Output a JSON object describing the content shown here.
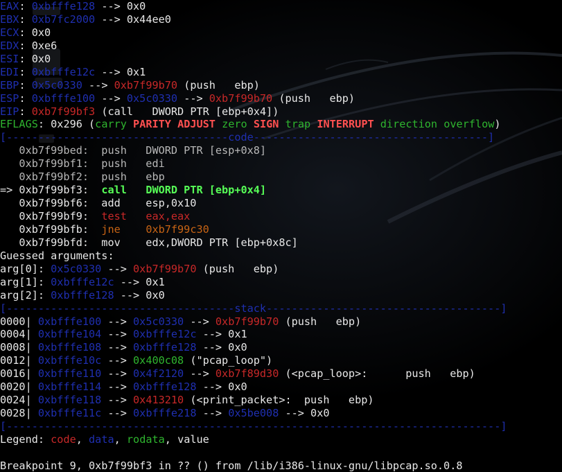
{
  "terminal": {
    "lines": [
      [
        {
          "t": "EAX",
          "c": "blue"
        },
        {
          "t": ": ",
          "c": "white"
        },
        {
          "t": "0xbfffe128",
          "c": "blue"
        },
        {
          "t": " --> 0x0",
          "c": "white"
        }
      ],
      [
        {
          "t": "EBX",
          "c": "blue"
        },
        {
          "t": ": ",
          "c": "white"
        },
        {
          "t": "0xb7fc2000",
          "c": "blue"
        },
        {
          "t": " --> 0x44ee0",
          "c": "white"
        }
      ],
      [
        {
          "t": "ECX",
          "c": "blue"
        },
        {
          "t": ": 0x0",
          "c": "white"
        }
      ],
      [
        {
          "t": "EDX",
          "c": "blue"
        },
        {
          "t": ": 0xe6",
          "c": "white"
        }
      ],
      [
        {
          "t": "ESI",
          "c": "blue"
        },
        {
          "t": ": 0x0",
          "c": "white"
        }
      ],
      [
        {
          "t": "EDI",
          "c": "blue"
        },
        {
          "t": ": ",
          "c": "white"
        },
        {
          "t": "0xbfffe12c",
          "c": "blue"
        },
        {
          "t": " --> 0x1",
          "c": "white"
        }
      ],
      [
        {
          "t": "EBP",
          "c": "blue"
        },
        {
          "t": ": ",
          "c": "white"
        },
        {
          "t": "0x5c0330",
          "c": "blue"
        },
        {
          "t": " --> ",
          "c": "white"
        },
        {
          "t": "0xb7f99b70",
          "c": "red"
        },
        {
          "t": " (push   ebp)",
          "c": "white"
        }
      ],
      [
        {
          "t": "ESP",
          "c": "blue"
        },
        {
          "t": ": ",
          "c": "white"
        },
        {
          "t": "0xbfffe100",
          "c": "blue"
        },
        {
          "t": " --> ",
          "c": "white"
        },
        {
          "t": "0x5c0330",
          "c": "blue"
        },
        {
          "t": " --> ",
          "c": "white"
        },
        {
          "t": "0xb7f99b70",
          "c": "red"
        },
        {
          "t": " (push   ebp)",
          "c": "white"
        }
      ],
      [
        {
          "t": "EIP",
          "c": "blue"
        },
        {
          "t": ": ",
          "c": "white"
        },
        {
          "t": "0xb7f99bf3",
          "c": "red"
        },
        {
          "t": " (call   DWORD PTR [ebp+0x4])",
          "c": "white"
        }
      ],
      [
        {
          "t": "EFLAGS",
          "c": "green"
        },
        {
          "t": ": 0x296 (",
          "c": "white"
        },
        {
          "t": "carry",
          "c": "green"
        },
        {
          "t": " ",
          "c": "white"
        },
        {
          "t": "PARITY",
          "c": "redb"
        },
        {
          "t": " ",
          "c": "white"
        },
        {
          "t": "ADJUST",
          "c": "redb"
        },
        {
          "t": " ",
          "c": "white"
        },
        {
          "t": "zero",
          "c": "green"
        },
        {
          "t": " ",
          "c": "white"
        },
        {
          "t": "SIGN",
          "c": "redb"
        },
        {
          "t": " ",
          "c": "white"
        },
        {
          "t": "trap",
          "c": "green"
        },
        {
          "t": " ",
          "c": "white"
        },
        {
          "t": "INTERRUPT",
          "c": "redb"
        },
        {
          "t": " ",
          "c": "white"
        },
        {
          "t": "direction",
          "c": "green"
        },
        {
          "t": " ",
          "c": "white"
        },
        {
          "t": "overflow",
          "c": "green"
        },
        {
          "t": ")",
          "c": "white"
        }
      ],
      [
        {
          "t": "[-----------------------------------code-------------------------------------]",
          "c": "banner"
        }
      ],
      [
        {
          "t": "   0xb7f99bed:\tpush   DWORD PTR [esp+0x8]",
          "c": "gray"
        }
      ],
      [
        {
          "t": "   0xb7f99bf1:\tpush   edi",
          "c": "gray"
        }
      ],
      [
        {
          "t": "   0xb7f99bf2:\tpush   ebp",
          "c": "gray"
        }
      ],
      [
        {
          "t": "=> 0xb7f99bf3:\t",
          "c": "white"
        },
        {
          "t": "call   DWORD PTR [ebp+0x4]",
          "c": "greenb"
        }
      ],
      [
        {
          "t": "   0xb7f99bf6:\tadd    esp,0x10",
          "c": "white"
        }
      ],
      [
        {
          "t": "   0xb7f99bf9:\t",
          "c": "white"
        },
        {
          "t": "test   eax,eax",
          "c": "red"
        }
      ],
      [
        {
          "t": "   0xb7f99bfb:\t",
          "c": "white"
        },
        {
          "t": "jne    0xb7f99c30",
          "c": "orange"
        }
      ],
      [
        {
          "t": "   0xb7f99bfd:\tmov    edx,DWORD PTR [ebp+0x8c]",
          "c": "white"
        }
      ],
      [
        {
          "t": "Guessed arguments:",
          "c": "white"
        }
      ],
      [
        {
          "t": "arg[0]: ",
          "c": "white"
        },
        {
          "t": "0x5c0330",
          "c": "blue"
        },
        {
          "t": " --> ",
          "c": "white"
        },
        {
          "t": "0xb7f99b70",
          "c": "red"
        },
        {
          "t": " (push   ebp)",
          "c": "white"
        }
      ],
      [
        {
          "t": "arg[1]: ",
          "c": "white"
        },
        {
          "t": "0xbfffe12c",
          "c": "blue"
        },
        {
          "t": " --> 0x1",
          "c": "white"
        }
      ],
      [
        {
          "t": "arg[2]: ",
          "c": "white"
        },
        {
          "t": "0xbfffe128",
          "c": "blue"
        },
        {
          "t": " --> 0x0",
          "c": "white"
        }
      ],
      [
        {
          "t": "[------------------------------------stack-------------------------------------]",
          "c": "banner"
        }
      ],
      [
        {
          "t": "0000| ",
          "c": "white"
        },
        {
          "t": "0xbfffe100",
          "c": "blue"
        },
        {
          "t": " --> ",
          "c": "white"
        },
        {
          "t": "0x5c0330",
          "c": "blue"
        },
        {
          "t": " --> ",
          "c": "white"
        },
        {
          "t": "0xb7f99b70",
          "c": "red"
        },
        {
          "t": " (push   ebp)",
          "c": "white"
        }
      ],
      [
        {
          "t": "0004| ",
          "c": "white"
        },
        {
          "t": "0xbfffe104",
          "c": "blue"
        },
        {
          "t": " --> ",
          "c": "white"
        },
        {
          "t": "0xbfffe12c",
          "c": "blue"
        },
        {
          "t": " --> 0x1",
          "c": "white"
        }
      ],
      [
        {
          "t": "0008| ",
          "c": "white"
        },
        {
          "t": "0xbfffe108",
          "c": "blue"
        },
        {
          "t": " --> ",
          "c": "white"
        },
        {
          "t": "0xbfffe128",
          "c": "blue"
        },
        {
          "t": " --> 0x0",
          "c": "white"
        }
      ],
      [
        {
          "t": "0012| ",
          "c": "white"
        },
        {
          "t": "0xbfffe10c",
          "c": "blue"
        },
        {
          "t": " --> ",
          "c": "white"
        },
        {
          "t": "0x400c08",
          "c": "green"
        },
        {
          "t": " (\"pcap_loop\")",
          "c": "white"
        }
      ],
      [
        {
          "t": "0016| ",
          "c": "white"
        },
        {
          "t": "0xbfffe110",
          "c": "blue"
        },
        {
          "t": " --> ",
          "c": "white"
        },
        {
          "t": "0x4f2120",
          "c": "blue"
        },
        {
          "t": " --> ",
          "c": "white"
        },
        {
          "t": "0xb7f89d30",
          "c": "red"
        },
        {
          "t": " (<pcap_loop>:\tpush   ebp)",
          "c": "white"
        }
      ],
      [
        {
          "t": "0020| ",
          "c": "white"
        },
        {
          "t": "0xbfffe114",
          "c": "blue"
        },
        {
          "t": " --> ",
          "c": "white"
        },
        {
          "t": "0xbfffe128",
          "c": "blue"
        },
        {
          "t": " --> 0x0",
          "c": "white"
        }
      ],
      [
        {
          "t": "0024| ",
          "c": "white"
        },
        {
          "t": "0xbfffe118",
          "c": "blue"
        },
        {
          "t": " --> ",
          "c": "white"
        },
        {
          "t": "0x413210",
          "c": "red"
        },
        {
          "t": " (<print_packet>:\tpush   ebp)",
          "c": "white"
        }
      ],
      [
        {
          "t": "0028| ",
          "c": "white"
        },
        {
          "t": "0xbfffe11c",
          "c": "blue"
        },
        {
          "t": " --> ",
          "c": "white"
        },
        {
          "t": "0xbfffe218",
          "c": "blue"
        },
        {
          "t": " --> ",
          "c": "white"
        },
        {
          "t": "0x5be008",
          "c": "blue"
        },
        {
          "t": " --> 0x0",
          "c": "white"
        }
      ],
      [
        {
          "t": "[------------------------------------------------------------------------------]",
          "c": "banner"
        }
      ],
      [
        {
          "t": "Legend: ",
          "c": "white"
        },
        {
          "t": "code",
          "c": "red"
        },
        {
          "t": ", ",
          "c": "white"
        },
        {
          "t": "data",
          "c": "blue"
        },
        {
          "t": ", ",
          "c": "white"
        },
        {
          "t": "rodata",
          "c": "green"
        },
        {
          "t": ", value",
          "c": "white"
        }
      ],
      [],
      [
        {
          "t": "Breakpoint 9, 0xb7f99bf3 in ?? () from /lib/i386-linux-gnu/libpcap.so.0.8",
          "c": "white"
        }
      ]
    ]
  }
}
